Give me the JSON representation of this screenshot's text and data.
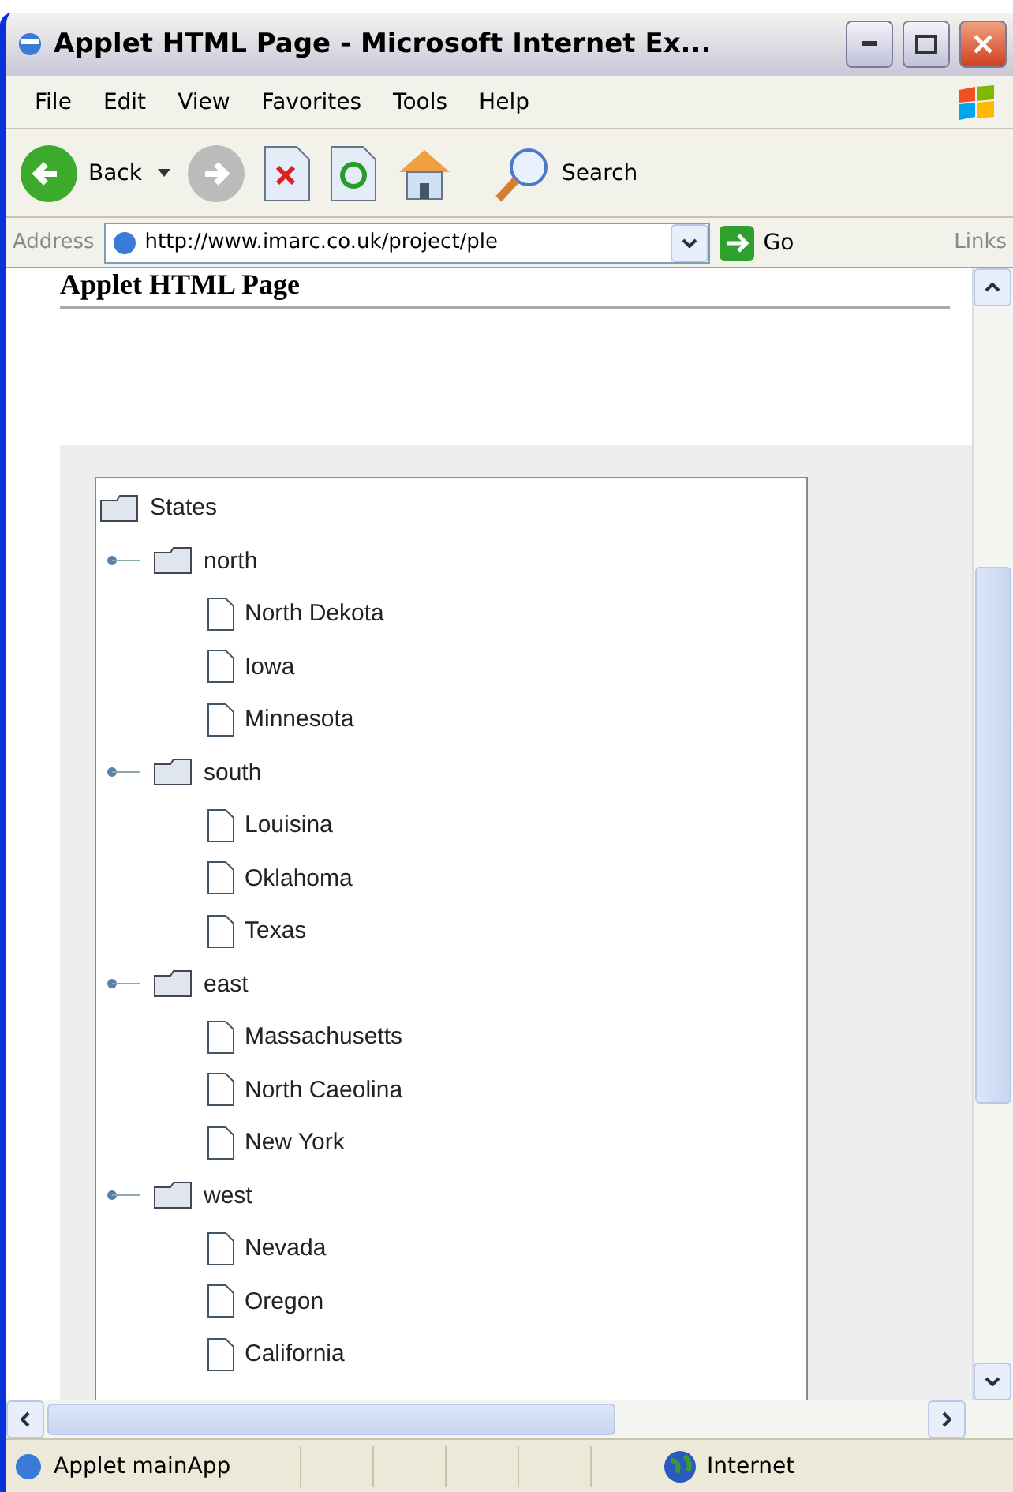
{
  "window": {
    "title": "Applet HTML Page - Microsoft Internet Ex..."
  },
  "menu": [
    "File",
    "Edit",
    "View",
    "Favorites",
    "Tools",
    "Help"
  ],
  "toolbar": {
    "back": "Back",
    "search": "Search"
  },
  "address": {
    "label": "Address",
    "url": "http://www.imarc.co.uk/project/ple",
    "go": "Go",
    "links": "Links"
  },
  "page": {
    "heading": "Applet HTML Page"
  },
  "tree": {
    "label": "States",
    "children": [
      {
        "label": "north",
        "expanded": true,
        "children": [
          {
            "label": "North Dekota"
          },
          {
            "label": "Iowa"
          },
          {
            "label": "Minnesota"
          }
        ]
      },
      {
        "label": "south",
        "expanded": true,
        "children": [
          {
            "label": "Louisina"
          },
          {
            "label": "Oklahoma"
          },
          {
            "label": "Texas"
          }
        ]
      },
      {
        "label": "east",
        "expanded": true,
        "children": [
          {
            "label": "Massachusetts"
          },
          {
            "label": "North Caeolina"
          },
          {
            "label": "New York"
          }
        ]
      },
      {
        "label": "west",
        "expanded": true,
        "children": [
          {
            "label": "Nevada"
          },
          {
            "label": "Oregon"
          },
          {
            "label": "California"
          }
        ]
      }
    ]
  },
  "status_bar": {
    "text": "Applet mainApp",
    "zone": "Internet"
  }
}
